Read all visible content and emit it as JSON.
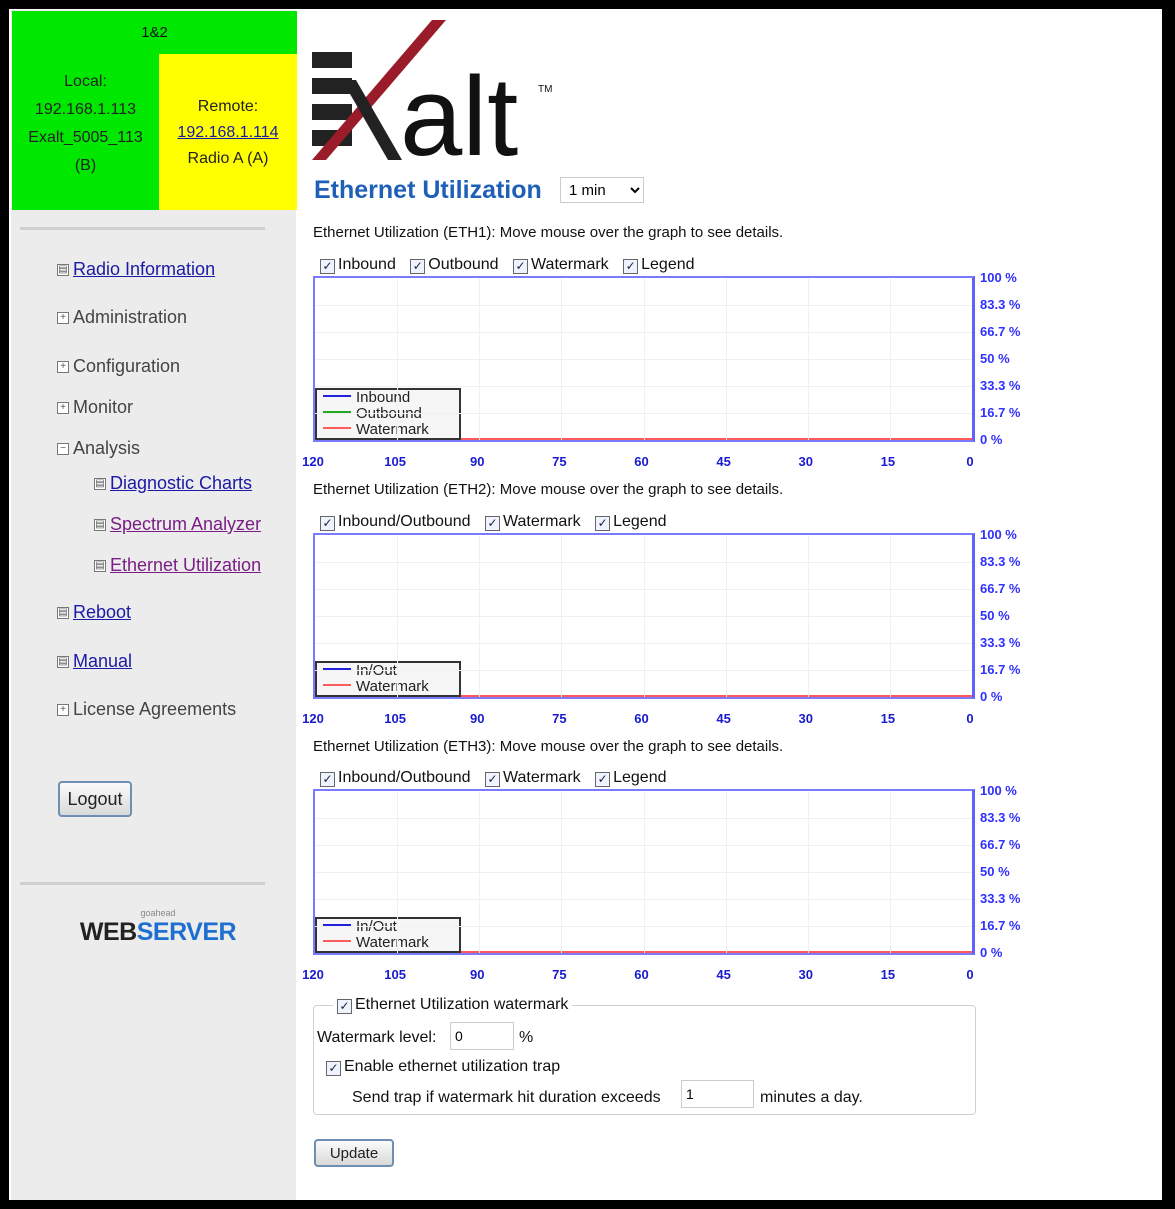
{
  "status": {
    "header": "1&2",
    "local": {
      "label": "Local:",
      "ip": "192.168.1.113",
      "name": "Exalt_5005_113",
      "id": "(B)"
    },
    "remote": {
      "label": "Remote:",
      "ip": "192.168.1.114",
      "radio": "Radio A (A)"
    }
  },
  "nav": {
    "items": [
      {
        "label": "Radio Information",
        "icon": "page-icon",
        "link": true
      },
      {
        "label": "Administration",
        "icon": "plus-icon",
        "link": false
      },
      {
        "label": "Configuration",
        "icon": "plus-icon",
        "link": false
      },
      {
        "label": "Monitor",
        "icon": "plus-icon",
        "link": false
      },
      {
        "label": "Analysis",
        "icon": "minus-icon",
        "link": false
      },
      {
        "label": "Diagnostic Charts",
        "icon": "page-icon",
        "link": true
      },
      {
        "label": "Spectrum Analyzer",
        "icon": "page-icon",
        "link": true
      },
      {
        "label": "Ethernet Utilization",
        "icon": "page-icon",
        "link": true
      },
      {
        "label": "Reboot",
        "icon": "page-icon",
        "link": true
      },
      {
        "label": "Manual",
        "icon": "page-icon",
        "link": true
      },
      {
        "label": "License Agreements",
        "icon": "plus-icon",
        "link": false
      }
    ],
    "logout": "Logout"
  },
  "footer_logo": {
    "small": "goahead",
    "web": "WEB",
    "server": "SERVER"
  },
  "brand": {
    "logo_text": "alt",
    "tm": "TM"
  },
  "page": {
    "title": "Ethernet Utilization",
    "interval": "1 min"
  },
  "charts": [
    {
      "caption": "Ethernet Utilization (ETH1): Move mouse over the graph to see details.",
      "checkboxes": [
        "Inbound",
        "Outbound",
        "Watermark",
        "Legend"
      ],
      "legend": [
        "Inbound",
        "Outbound",
        "Watermark"
      ]
    },
    {
      "caption": "Ethernet Utilization (ETH2): Move mouse over the graph to see details.",
      "checkboxes": [
        "Inbound/Outbound",
        "Watermark",
        "Legend"
      ],
      "legend": [
        "In/Out",
        "Watermark"
      ]
    },
    {
      "caption": "Ethernet Utilization (ETH3): Move mouse over the graph to see details.",
      "checkboxes": [
        "Inbound/Outbound",
        "Watermark",
        "Legend"
      ],
      "legend": [
        "In/Out",
        "Watermark"
      ]
    }
  ],
  "chart_data": [
    {
      "type": "line",
      "x": [
        120,
        105,
        90,
        75,
        60,
        45,
        30,
        15,
        0
      ],
      "xlim": [
        120,
        0
      ],
      "y_ticks": [
        "100 %",
        "83.3 %",
        "66.7 %",
        "50 %",
        "33.3 %",
        "16.7 %",
        "0 %"
      ],
      "ylim": [
        0,
        100
      ],
      "series": [
        {
          "name": "Inbound",
          "color": "#2222dd",
          "values": []
        },
        {
          "name": "Outbound",
          "color": "#22aa22",
          "values": []
        },
        {
          "name": "Watermark",
          "color": "#ff5a5a",
          "values": [
            0,
            0,
            0,
            0,
            0,
            0,
            0,
            0,
            0
          ]
        }
      ],
      "legend": "bottom-left"
    },
    {
      "type": "line",
      "x": [
        120,
        105,
        90,
        75,
        60,
        45,
        30,
        15,
        0
      ],
      "xlim": [
        120,
        0
      ],
      "y_ticks": [
        "100 %",
        "83.3 %",
        "66.7 %",
        "50 %",
        "33.3 %",
        "16.7 %",
        "0 %"
      ],
      "ylim": [
        0,
        100
      ],
      "series": [
        {
          "name": "In/Out",
          "color": "#2222dd",
          "values": []
        },
        {
          "name": "Watermark",
          "color": "#ff5a5a",
          "values": [
            0,
            0,
            0,
            0,
            0,
            0,
            0,
            0,
            0
          ]
        }
      ],
      "legend": "bottom-left"
    },
    {
      "type": "line",
      "x": [
        120,
        105,
        90,
        75,
        60,
        45,
        30,
        15,
        0
      ],
      "xlim": [
        120,
        0
      ],
      "y_ticks": [
        "100 %",
        "83.3 %",
        "66.7 %",
        "50 %",
        "33.3 %",
        "16.7 %",
        "0 %"
      ],
      "ylim": [
        0,
        100
      ],
      "series": [
        {
          "name": "In/Out",
          "color": "#2222dd",
          "values": []
        },
        {
          "name": "Watermark",
          "color": "#ff5a5a",
          "values": [
            0,
            0,
            0,
            0,
            0,
            0,
            0,
            0,
            0
          ]
        }
      ],
      "legend": "bottom-left"
    }
  ],
  "watermark": {
    "section_label": "Ethernet Utilization watermark",
    "level_label": "Watermark level:",
    "level_value": "0",
    "level_unit": "%",
    "trap_label": "Enable ethernet utilization trap",
    "send_label": "Send trap if watermark hit duration exceeds",
    "duration_value": "1",
    "duration_unit": "minutes a day."
  },
  "actions": {
    "update": "Update"
  },
  "colors": {
    "status_green": "#00e800",
    "status_yellow": "#ffff00",
    "title_blue": "#1e5fb8",
    "axis_blue": "#3030ff",
    "watermark_red": "#ff5a5a"
  }
}
